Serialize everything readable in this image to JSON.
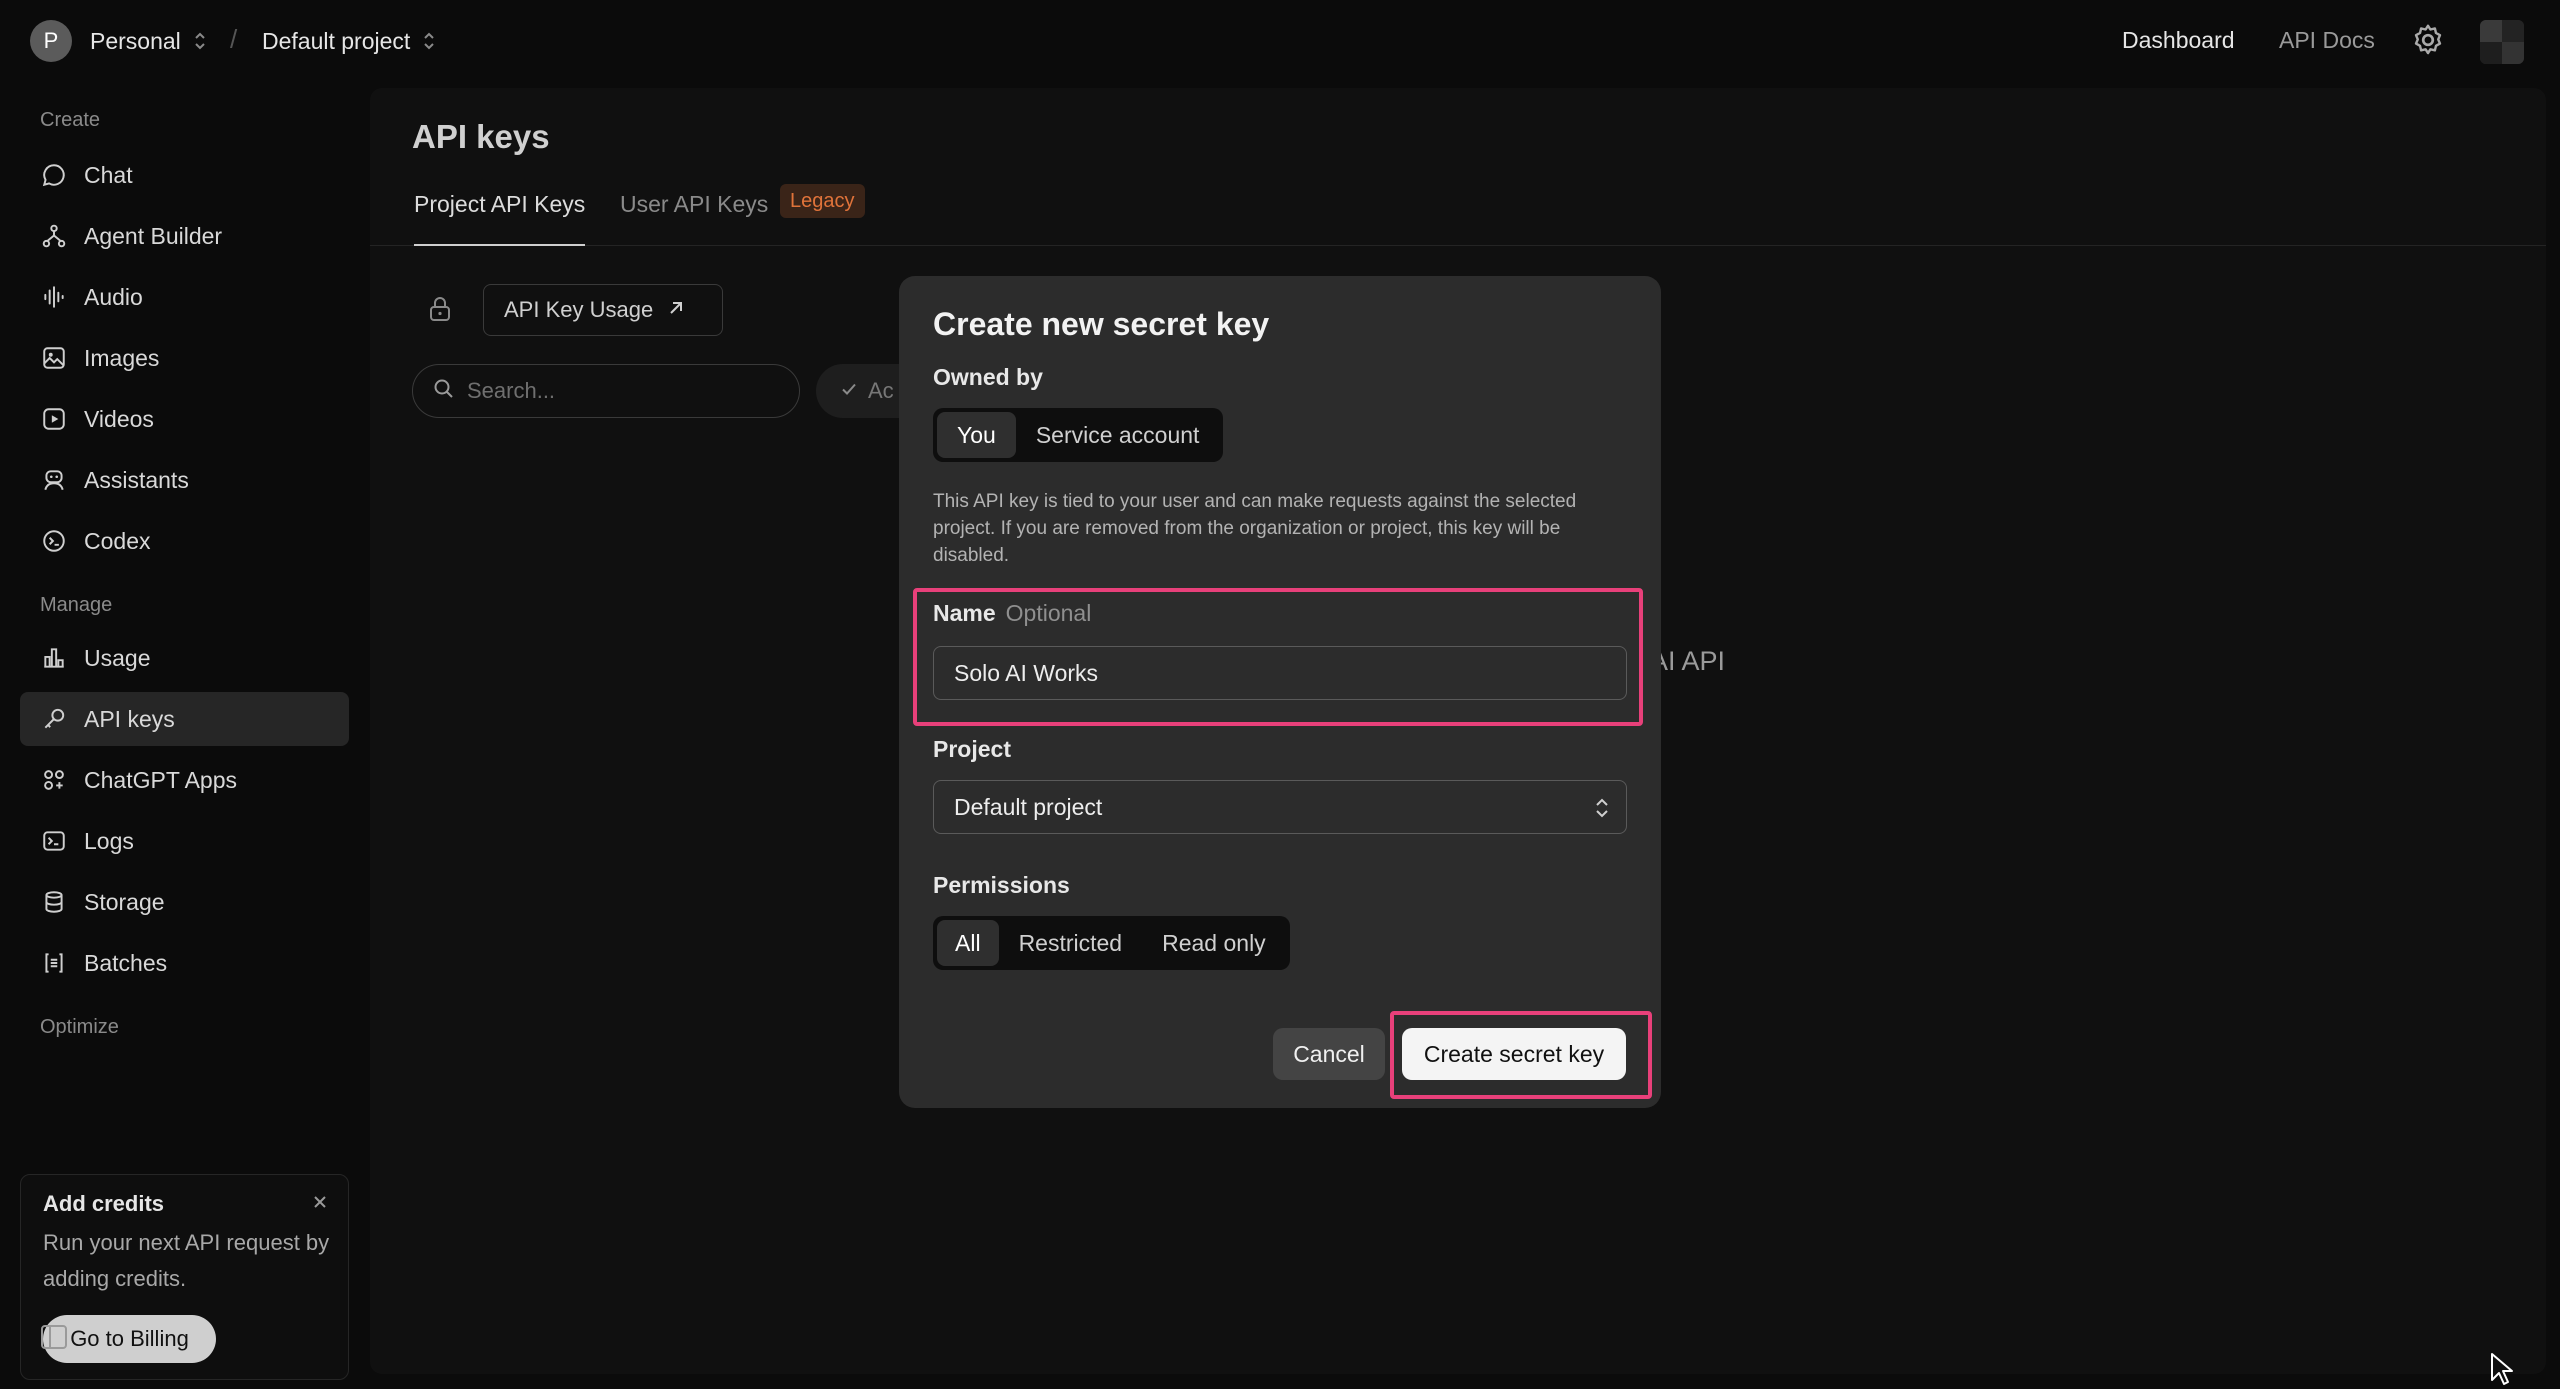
{
  "topbar": {
    "org_initial": "P",
    "org_name": "Personal",
    "project_name": "Default project",
    "nav": {
      "dashboard": "Dashboard",
      "api_docs": "API Docs"
    }
  },
  "sidebar": {
    "create_heading": "Create",
    "create_items": [
      {
        "label": "Chat",
        "icon": "chat-bubble-icon"
      },
      {
        "label": "Agent Builder",
        "icon": "agent-builder-icon"
      },
      {
        "label": "Audio",
        "icon": "audio-waveform-icon"
      },
      {
        "label": "Images",
        "icon": "image-icon"
      },
      {
        "label": "Videos",
        "icon": "video-play-icon"
      },
      {
        "label": "Assistants",
        "icon": "assistant-robot-icon"
      },
      {
        "label": "Codex",
        "icon": "codex-terminal-icon"
      }
    ],
    "manage_heading": "Manage",
    "manage_items": [
      {
        "label": "Usage",
        "icon": "bar-chart-icon"
      },
      {
        "label": "API keys",
        "icon": "key-icon",
        "active": true
      },
      {
        "label": "ChatGPT Apps",
        "icon": "apps-grid-icon"
      },
      {
        "label": "Logs",
        "icon": "logs-terminal-icon"
      },
      {
        "label": "Storage",
        "icon": "database-icon"
      },
      {
        "label": "Batches",
        "icon": "batches-list-icon"
      }
    ],
    "optimize_heading": "Optimize",
    "credits": {
      "title": "Add credits",
      "text": "Run your next API request by adding credits.",
      "button": "Go to Billing"
    }
  },
  "main": {
    "title": "API keys",
    "tabs": [
      {
        "label": "Project API Keys",
        "active": true
      },
      {
        "label": "User API Keys",
        "badge": "Legacy"
      }
    ],
    "usage_button": "API Key Usage",
    "search_placeholder": "Search...",
    "filter_chip": "Ac",
    "background_text": "AI API"
  },
  "modal": {
    "title": "Create new secret key",
    "owned_by_label": "Owned by",
    "owned_by_options": [
      "You",
      "Service account"
    ],
    "owned_by_selected": "You",
    "description": "This API key is tied to your user and can make requests against the selected project. If you are removed from the organization or project, this key will be disabled.",
    "name_label": "Name",
    "name_optional": "Optional",
    "name_value": "Solo AI Works",
    "project_label": "Project",
    "project_value": "Default project",
    "permissions_label": "Permissions",
    "permissions_options": [
      "All",
      "Restricted",
      "Read only"
    ],
    "permissions_selected": "All",
    "cancel": "Cancel",
    "create": "Create secret key"
  },
  "colors": {
    "background": "#0b0b0b",
    "panel": "#101010",
    "modal": "#2c2c2c",
    "highlight": "#e8407a",
    "legacy_badge_text": "#e0733a"
  }
}
